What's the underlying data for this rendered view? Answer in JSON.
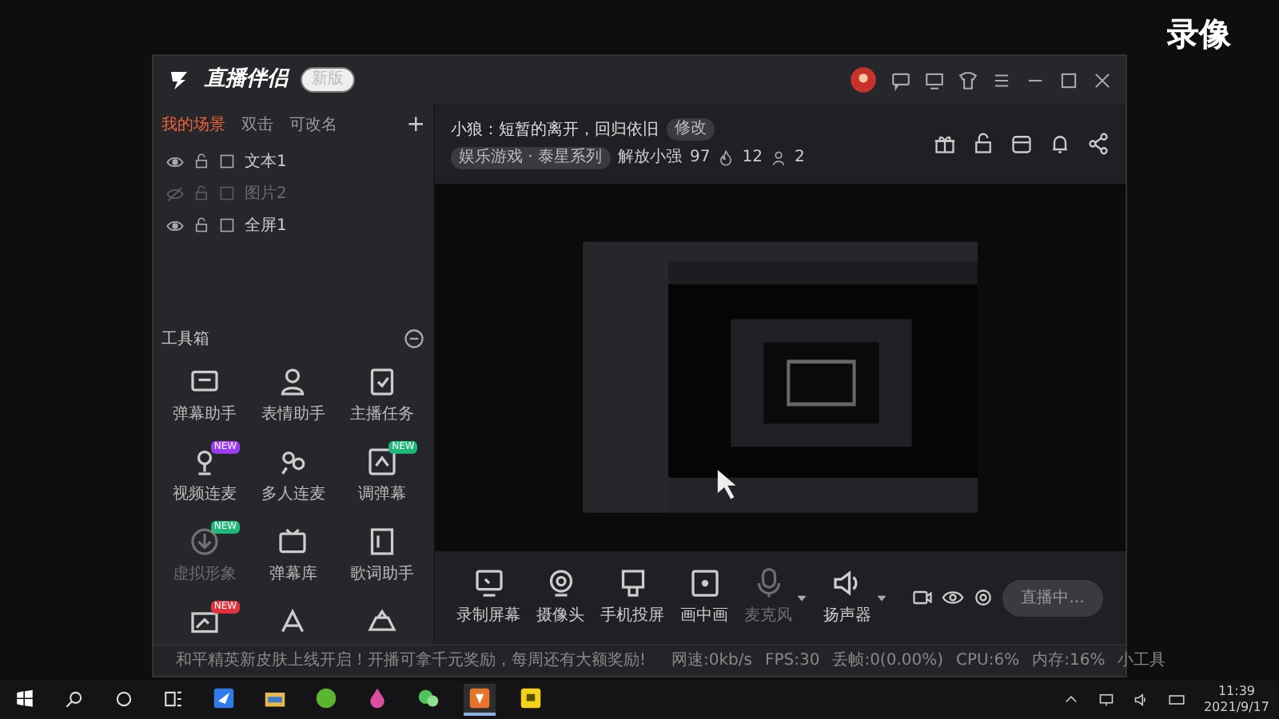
{
  "overlay_label": "录像",
  "app": {
    "name": "直播伴侣",
    "badge": "新版"
  },
  "scene_tabs": [
    {
      "label": "我的场景",
      "selected": true
    },
    {
      "label": "双击",
      "selected": false
    },
    {
      "label": "可改名",
      "selected": false
    }
  ],
  "add_scene": "+",
  "sources": [
    {
      "label": "文本1",
      "visible": true
    },
    {
      "label": "图片2",
      "visible": false
    },
    {
      "label": "全屏1",
      "visible": true
    }
  ],
  "stream": {
    "title": "小狼：短暂的离开，回归依旧",
    "edit_badge": "修改",
    "category": "娱乐游戏 · 泰星系列",
    "room": "解放小强",
    "room_number": "97",
    "hot": "12",
    "viewers": "2"
  },
  "toolbox": {
    "title": "工具箱",
    "tools": [
      {
        "label": "弹幕助手",
        "disabled": false
      },
      {
        "label": "表情助手",
        "disabled": false
      },
      {
        "label": "主播任务",
        "disabled": false
      },
      {
        "label": "视频连麦",
        "badge": "NEW",
        "color": "#9b3cf0",
        "disabled": false
      },
      {
        "label": "多人连麦",
        "disabled": false
      },
      {
        "label": "调弹幕",
        "badge": "NEW",
        "color": "#1fb77a",
        "disabled": false
      },
      {
        "label": "虚拟形象",
        "badge": "NEW",
        "color": "#1fb77a",
        "disabled": true
      },
      {
        "label": "弹幕库",
        "disabled": false
      },
      {
        "label": "歌词助手",
        "disabled": false
      },
      {
        "badge": "NEW",
        "color": "#e0343c",
        "disabled": false
      },
      {
        "disabled": false
      },
      {
        "disabled": false
      }
    ]
  },
  "controls": [
    {
      "label": "录制屏幕",
      "disabled": false,
      "dropdown": false
    },
    {
      "label": "摄像头",
      "disabled": false,
      "dropdown": false
    },
    {
      "label": "手机投屏",
      "disabled": false,
      "dropdown": false
    },
    {
      "label": "画中画",
      "disabled": false,
      "dropdown": false
    },
    {
      "label": "麦克风",
      "disabled": true,
      "dropdown": true
    },
    {
      "label": "扬声器",
      "disabled": false,
      "dropdown": true
    }
  ],
  "live_button": "直播中...",
  "status": {
    "notice": "和平精英新皮肤上线开启！开播可拿千元奖励，每周还有大额奖励!",
    "stats": [
      "网速:0kb/s",
      "FPS:30",
      "丢帧:0(0.00%)",
      "CPU:6%",
      "内存:16%"
    ],
    "last": "小工具"
  },
  "taskbar": {
    "apps": [
      {
        "selected": false
      },
      {
        "selected": false
      },
      {
        "selected": false
      },
      {
        "selected": false
      },
      {
        "selected": false
      },
      {
        "selected": true
      },
      {
        "selected": false
      }
    ],
    "time": "11:39",
    "date": "2021/9/17"
  }
}
